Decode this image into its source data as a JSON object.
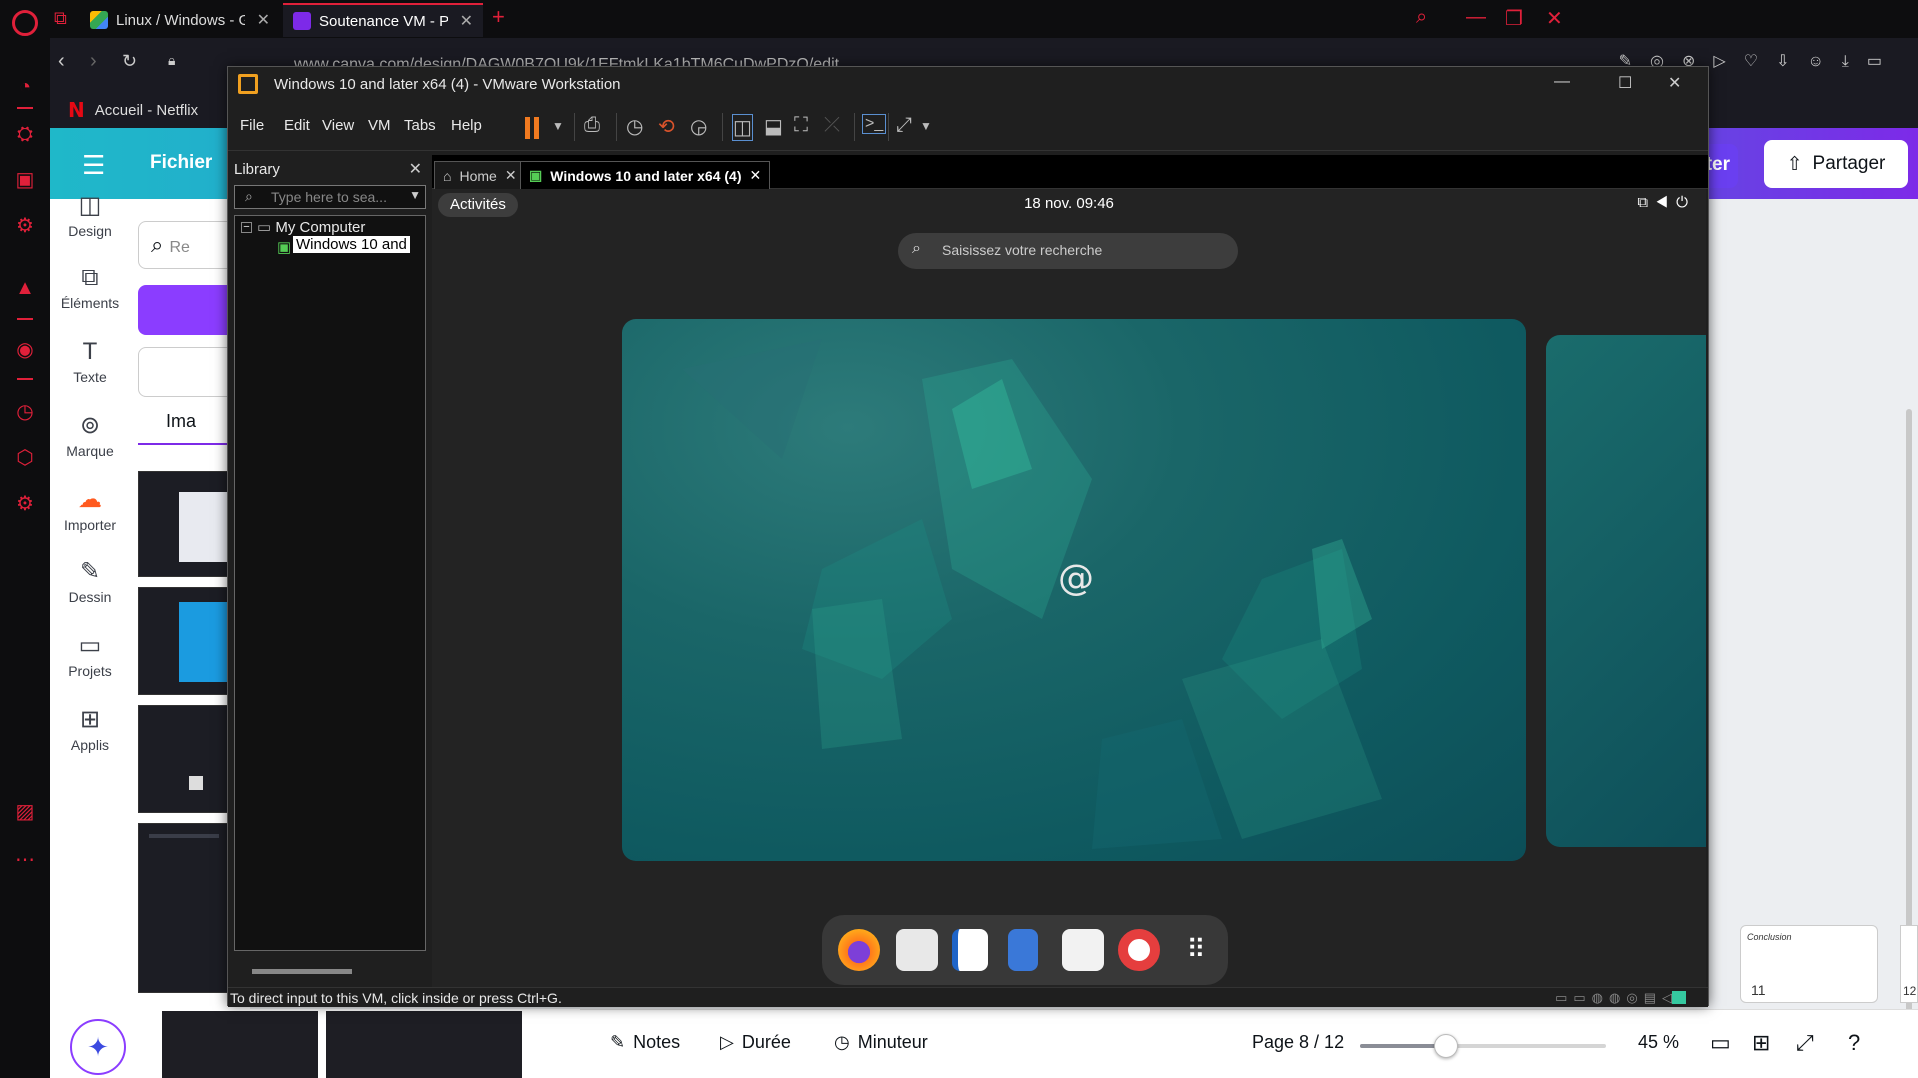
{
  "browser": {
    "tabs": [
      {
        "title": "Linux / Windows - Google D",
        "favicon_color": "#34a853"
      },
      {
        "title": "Soutenance VM - Présentatio",
        "favicon_color": "#7d2ae8"
      }
    ],
    "url": "www.canva.com/design/DAGW0B7QU9k/1EFtmkLKa1bTM6CuDwPDzQ/edit",
    "bookmark": "Accueil - Netflix",
    "accent": "#e0203a"
  },
  "canva": {
    "menu_label": "Fichier",
    "share_label": "Partager",
    "partial_button": "ter",
    "rail": [
      "Design",
      "Éléments",
      "Texte",
      "Marque",
      "Importer",
      "Dessin",
      "Projets",
      "Applis"
    ],
    "search_partial": "Re",
    "panel_tab": "Ima",
    "bottom": {
      "notes": "Notes",
      "duree": "Durée",
      "minuteur": "Minuteur",
      "page": "Page 8 / 12",
      "zoom": "45 %",
      "zoom_fraction": 0.35
    },
    "page_thumb": {
      "title": "Conclusion",
      "number": "11"
    },
    "page_thumb_next": "12"
  },
  "vmware": {
    "title": "Windows 10 and later x64 (4) - VMware Workstation",
    "menu": [
      "File",
      "Edit",
      "View",
      "VM",
      "Tabs",
      "Help"
    ],
    "library": {
      "title": "Library",
      "search_placeholder": "Type here to sea...",
      "root": "My Computer",
      "child": "Windows 10 and"
    },
    "tabs": [
      "Home",
      "Windows 10 and later x64 (4)"
    ],
    "status": "To direct input to this VM, click inside or press Ctrl+G."
  },
  "guest": {
    "activities": "Activités",
    "clock": "18 nov.  09:46",
    "search_placeholder": "Saisissez votre recherche",
    "dock": [
      "firefox-icon",
      "evolution-mail-icon",
      "writer-icon",
      "files-icon",
      "software-icon",
      "help-icon",
      "app-grid-icon"
    ]
  }
}
